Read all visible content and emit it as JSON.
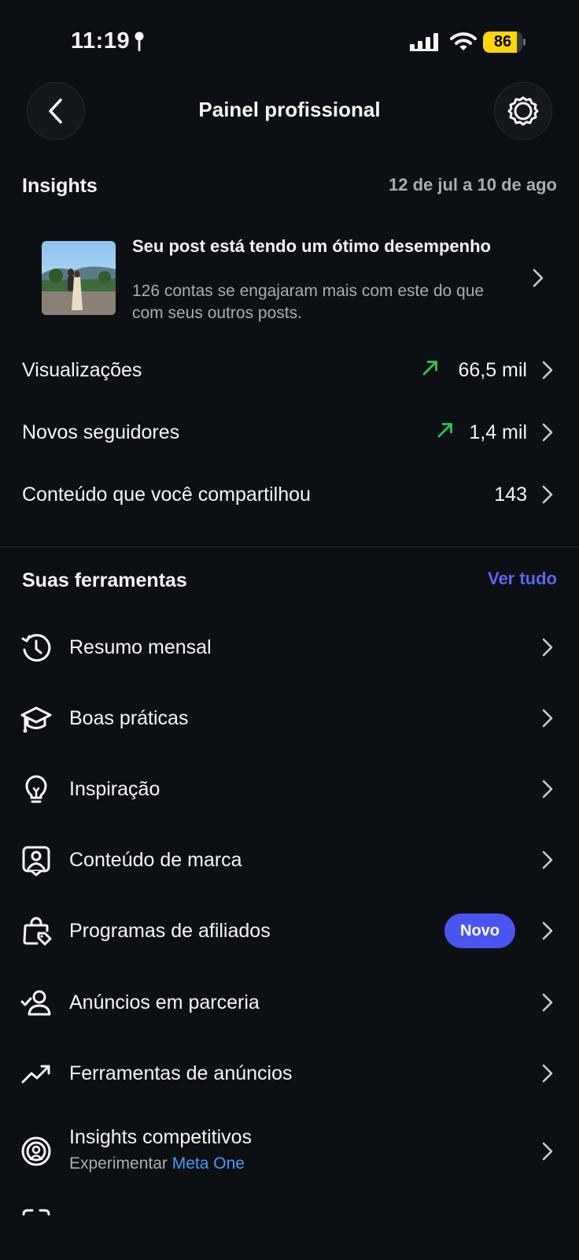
{
  "status_bar": {
    "time": "11:19",
    "battery_level": 86,
    "battery_text": "86",
    "battery_color": "#ffd60a"
  },
  "header": {
    "title": "Painel profissional",
    "back_icon": "chevron-left-icon",
    "settings_icon": "gear-icon"
  },
  "insights": {
    "title": "Insights",
    "date_range": "12 de jul a 10 de ago",
    "post": {
      "title": "Seu post está tendo um ótimo desempenho",
      "description": "126 contas se engajaram mais com este do que com seus outros posts."
    },
    "metrics": [
      {
        "label": "Visualizações",
        "value": "66,5 mil",
        "trend": "up",
        "trend_color": "#2fc45a"
      },
      {
        "label": "Novos seguidores",
        "value": "1,4 mil",
        "trend": "up",
        "trend_color": "#2fc45a"
      },
      {
        "label": "Conteúdo que você compartilhou",
        "value": "143"
      }
    ]
  },
  "tools": {
    "title": "Suas ferramentas",
    "see_all": "Ver tudo",
    "accent_color": "#5b66f5",
    "items": [
      {
        "label": "Resumo mensal",
        "icon": "history-clock-icon"
      },
      {
        "label": "Boas práticas",
        "icon": "graduation-cap-icon"
      },
      {
        "label": "Inspiração",
        "icon": "lightbulb-icon"
      },
      {
        "label": "Conteúdo de marca",
        "icon": "branded-content-icon"
      },
      {
        "label": "Programas de afiliados",
        "icon": "shopping-bag-tag-icon",
        "badge": "Novo"
      },
      {
        "label": "Anúncios em parceria",
        "icon": "person-check-icon"
      },
      {
        "label": "Ferramentas de anúncios",
        "icon": "trending-up-icon"
      },
      {
        "label": "Insights competitivos",
        "icon": "radar-person-icon",
        "subtitle_prefix": "Experimentar",
        "subtitle_link": "Meta One"
      }
    ]
  }
}
